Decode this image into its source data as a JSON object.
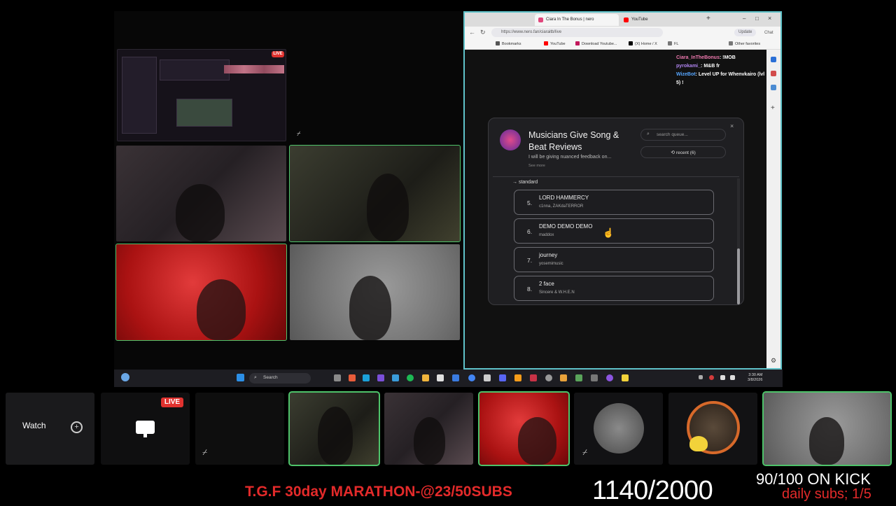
{
  "stream": {
    "left_live_badge": "LIVE",
    "strip_live_badge": "LIVE",
    "watch_label": "Watch"
  },
  "browser": {
    "tabs": [
      {
        "label": "Ciara In The Bonus | nero",
        "color": "#e1467c"
      },
      {
        "label": "YouTube",
        "color": "#ff0000"
      }
    ],
    "url": "https://www.nero.fan/ciaraitb/live",
    "update_label": "Update",
    "chat_btn": "Chat",
    "bookmarks": [
      "Bookmarks",
      "YouTube",
      "Download Youtube...",
      "(X) Home / X",
      "FL",
      "Other favorites"
    ]
  },
  "chat": [
    {
      "user": "Ciara_InTheBonus",
      "message": "!MOB",
      "color": "#f07ab0"
    },
    {
      "user": "pyrokami_",
      "message": "M&B fr",
      "color": "#b084f0"
    },
    {
      "user": "WizeBot",
      "message": "Level UP for Whenvkairo (lvl 5) !",
      "color": "#56a6ff"
    }
  ],
  "modal": {
    "title": "Musicians Give Song & Beat Reviews",
    "description": "I will be giving nuanced feedback on...",
    "see_more": "See more",
    "search_placeholder": "search queue...",
    "recent_label": "recent (6)",
    "close": "×",
    "queue_label": "standard",
    "queue": [
      {
        "num": "5.",
        "song": "LORD HAMMERCY",
        "artist": "c1nna, ZAKdaTERROR"
      },
      {
        "num": "6.",
        "song": "DEMO DEMO DEMO",
        "artist": "maddox"
      },
      {
        "num": "7.",
        "song": "journey",
        "artist": "yosemimusic"
      },
      {
        "num": "8.",
        "song": "2 face",
        "artist": "Sincere & W.H.E.N"
      }
    ]
  },
  "taskbar": {
    "search_label": "Search",
    "time": "3:30 AM",
    "date": "3/8/2026"
  },
  "overlay": {
    "marathon": "T.G.F 30day MARATHON-@23/50SUBS",
    "counter": "1140/2000",
    "kick": "90/100 ON KICK",
    "daily": "daily subs; 1/5"
  }
}
